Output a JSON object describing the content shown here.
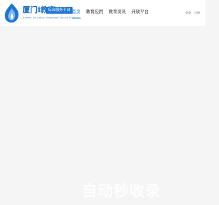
{
  "header": {
    "logo": {
      "title": "厦门i教育",
      "badge": "综合服务平台",
      "subtitle": "Xiamen Education Integrated Service Platform"
    },
    "nav": [
      "首页",
      "教育应用",
      "教育资讯",
      "开放平台"
    ],
    "active_nav_index": 0,
    "user": {
      "login": "登录",
      "register": "注册"
    }
  },
  "watermark": "自动秒收录",
  "colors": {
    "brand": "#1e74d2",
    "background": "#f5f5f5",
    "header": "#ffffff"
  }
}
